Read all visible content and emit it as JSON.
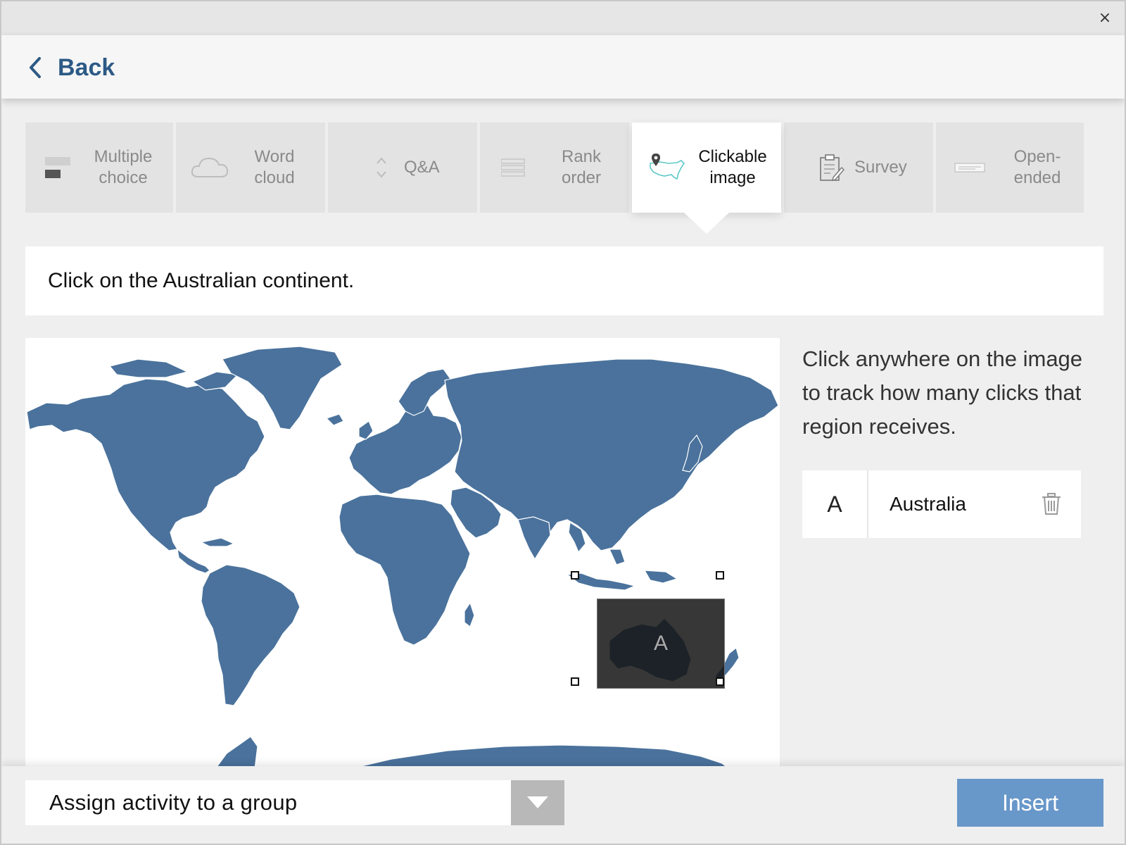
{
  "window": {
    "close_label": "×"
  },
  "header": {
    "back_label": "Back"
  },
  "tabs": [
    {
      "label_line1": "Multiple",
      "label_line2": "choice",
      "icon": "multiple-choice-icon",
      "active": false
    },
    {
      "label_line1": "Word",
      "label_line2": "cloud",
      "icon": "cloud-icon",
      "active": false
    },
    {
      "label_line1": "Q&A",
      "label_line2": "",
      "icon": "up-down-icon",
      "active": false
    },
    {
      "label_line1": "Rank",
      "label_line2": "order",
      "icon": "list-lines-icon",
      "active": false
    },
    {
      "label_line1": "Clickable",
      "label_line2": "image",
      "icon": "map-pin-icon",
      "active": true
    },
    {
      "label_line1": "Survey",
      "label_line2": "",
      "icon": "clipboard-icon",
      "active": false
    },
    {
      "label_line1": "Open-",
      "label_line2": "ended",
      "icon": "text-field-icon",
      "active": false
    }
  ],
  "question": {
    "text": "Click on the Australian continent."
  },
  "map": {
    "region_letter": "A",
    "land_color": "#4a729c"
  },
  "help": {
    "text": "Click anywhere on the image to track how many clicks that region receives."
  },
  "regions": [
    {
      "letter": "A",
      "name": "Australia"
    }
  ],
  "footer": {
    "group_select_value": "Assign activity to a group",
    "insert_label": "Insert"
  },
  "colors": {
    "accent": "#2d5a86",
    "insert_button": "#6897c9",
    "active_icon": "#5ec8c8"
  }
}
